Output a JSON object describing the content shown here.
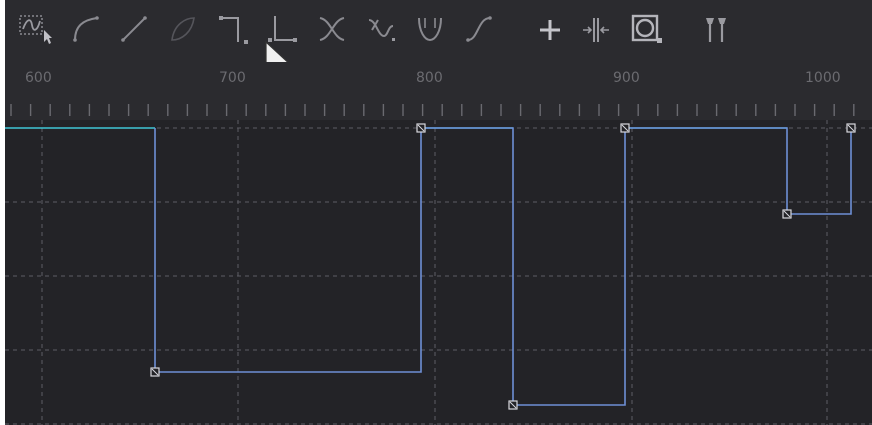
{
  "toolbar": {
    "tools": [
      {
        "name": "select-curve-tool-icon",
        "interactable": true
      },
      {
        "name": "smooth-curve-tool-icon",
        "interactable": true
      },
      {
        "name": "linear-tool-icon",
        "interactable": true
      },
      {
        "name": "bezier-tool-icon",
        "interactable": true
      },
      {
        "name": "step-in-tool-icon",
        "interactable": true
      },
      {
        "name": "step-out-tool-icon",
        "interactable": true
      },
      {
        "name": "flip-tool-icon",
        "interactable": true
      },
      {
        "name": "reverse-tool-icon",
        "interactable": true
      },
      {
        "name": "loop-tool-icon",
        "interactable": true
      },
      {
        "name": "ease-tool-icon",
        "interactable": true
      },
      {
        "name": "add-keyframe-icon",
        "interactable": true
      },
      {
        "name": "fit-icon",
        "interactable": true
      },
      {
        "name": "show-keyframes-icon",
        "interactable": true
      },
      {
        "name": "pin-icon",
        "interactable": true
      }
    ]
  },
  "ruler": {
    "labels": [
      "600",
      "700",
      "800",
      "900",
      "1000"
    ]
  },
  "graph": {
    "line_color": "#6e8fd6",
    "accent_color": "#3fc6d6",
    "grid_color": "#5c5c64"
  }
}
